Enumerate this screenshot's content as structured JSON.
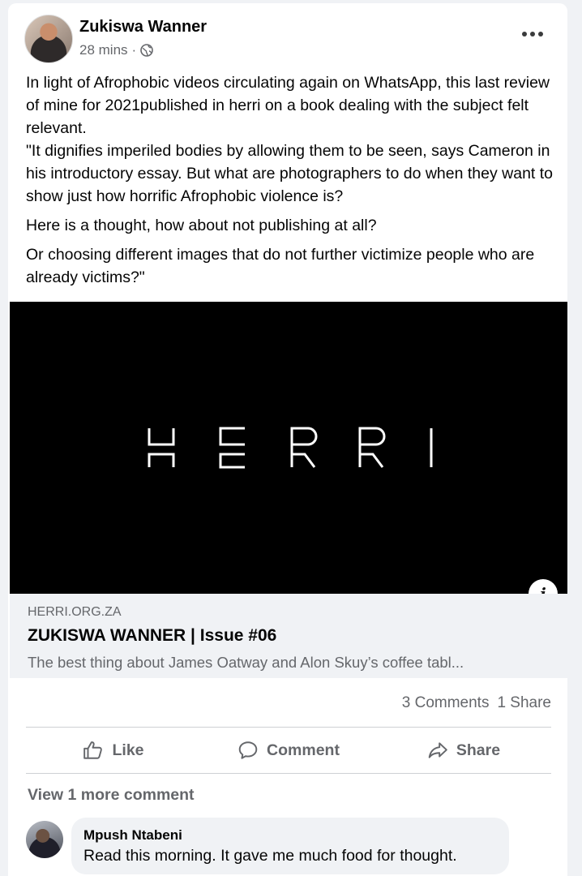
{
  "post": {
    "author": "Zukiswa Wanner",
    "time": "28 mins",
    "separator": "·",
    "paragraphs": [
      "In light of Afrophobic videos circulating again on WhatsApp, this last review of mine for 2021published in herri  on a book dealing with the subject felt relevant.",
      "\"It dignifies imperiled bodies by allowing them to be seen, says Cameron in his introductory essay. But what are photographers to do when they want to show just how horrific Afrophobic violence is?",
      "Here is a thought, how about not publishing at all?",
      "Or choosing different images that do not further victimize people who are already victims?\""
    ]
  },
  "link": {
    "image_logo": "HERRI",
    "domain": "HERRI.ORG.ZA",
    "title": "ZUKISWA WANNER | Issue #06",
    "description": "The best thing about James Oatway and Alon Skuy’s coffee tabl..."
  },
  "stats": {
    "comments": "3 Comments",
    "shares": "1 Share"
  },
  "actions": {
    "like": "Like",
    "comment": "Comment",
    "share": "Share"
  },
  "comments": {
    "view_more": "View 1 more comment",
    "items": [
      {
        "name": "Mpush Ntabeni",
        "text": "Read this morning. It gave me much food for thought."
      }
    ]
  },
  "icons": {
    "more": "more-horizontal-icon",
    "audience": "globe-icon",
    "info": "info-icon",
    "like": "thumbs-up-icon",
    "comment": "speech-bubble-icon",
    "share": "share-arrow-icon"
  }
}
